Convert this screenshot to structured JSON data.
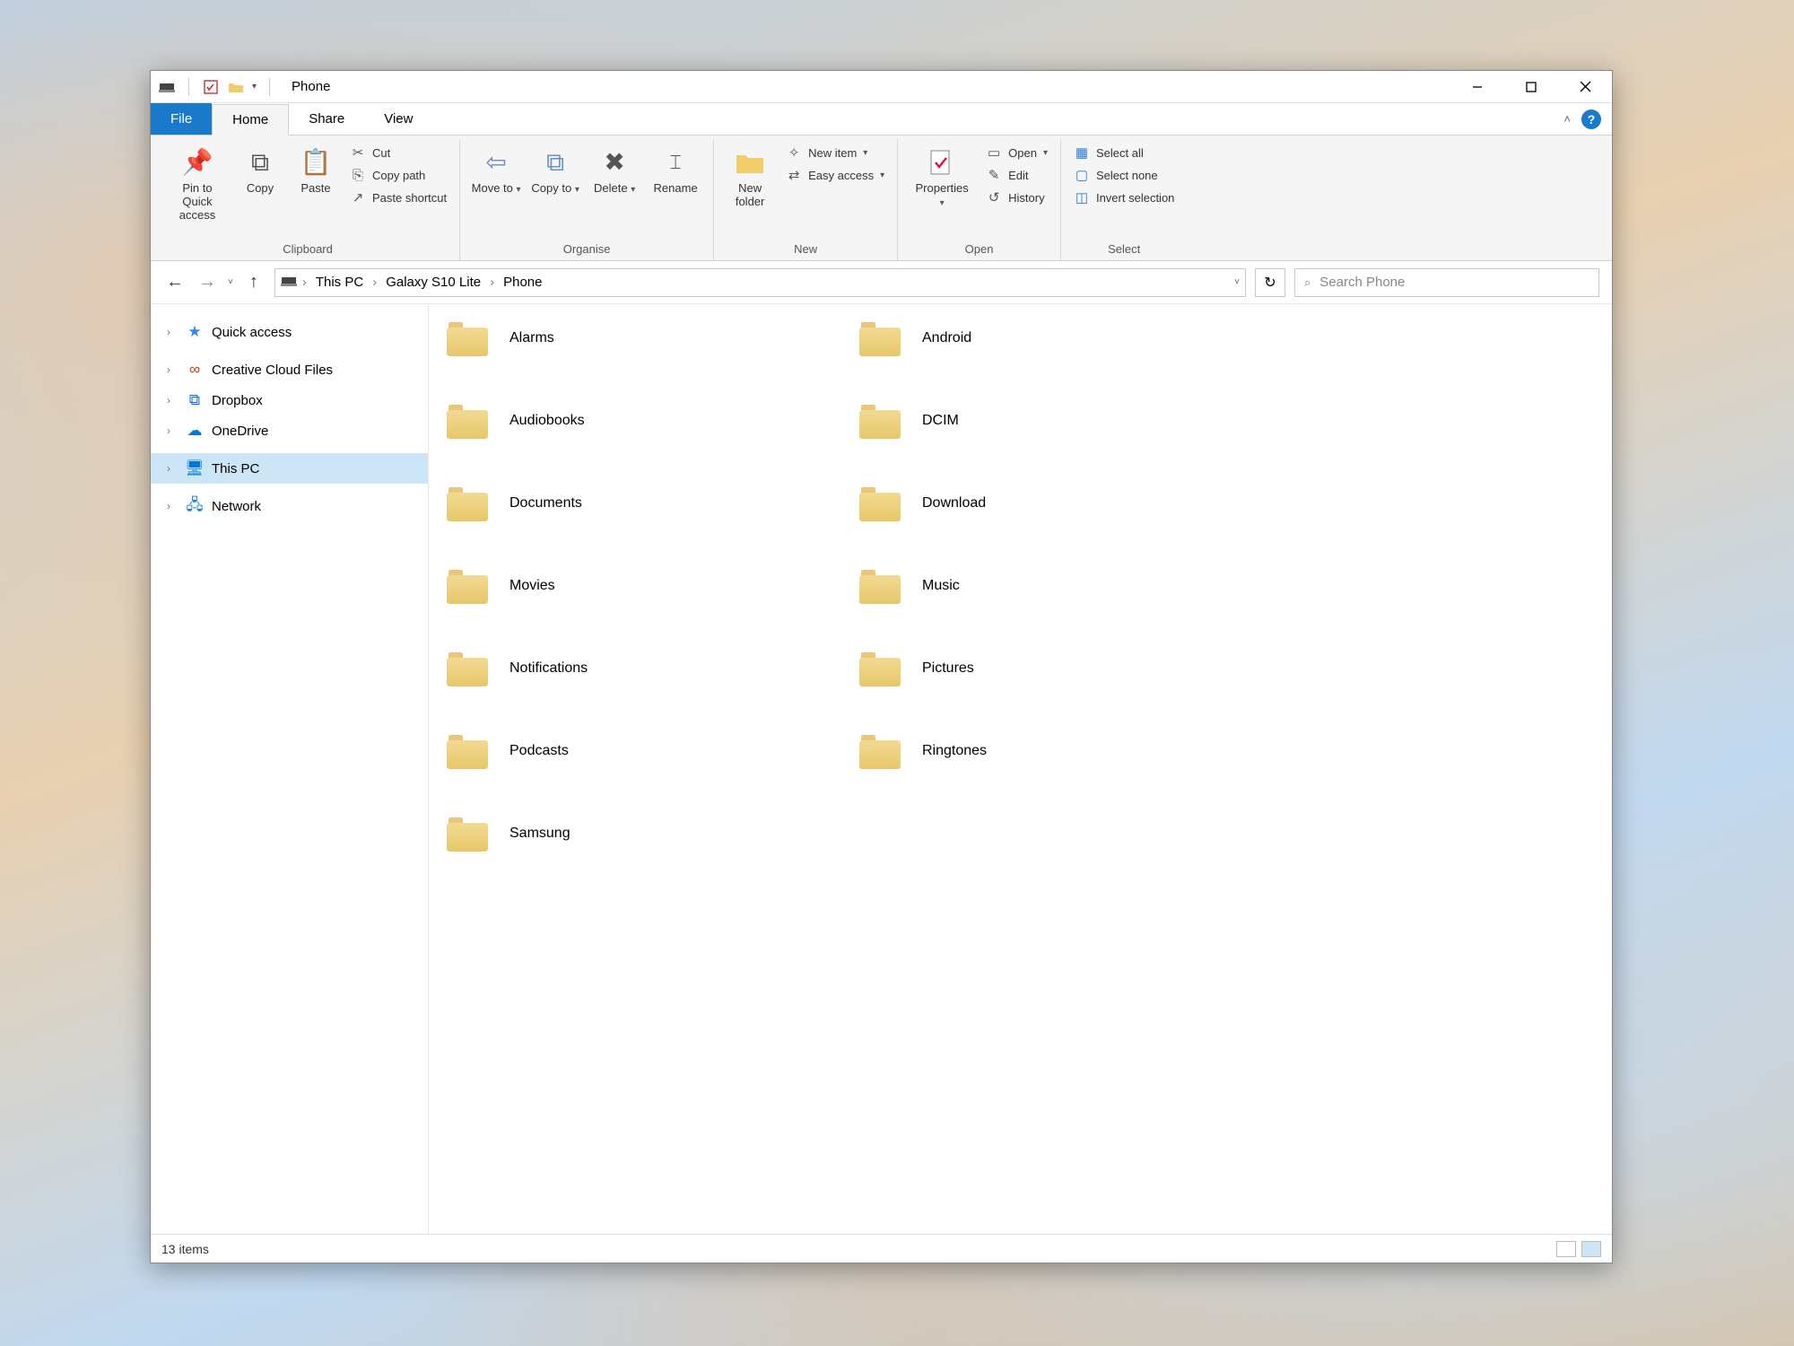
{
  "window": {
    "title": "Phone"
  },
  "tabs": {
    "file": "File",
    "home": "Home",
    "share": "Share",
    "view": "View"
  },
  "ribbon": {
    "clipboard": {
      "label": "Clipboard",
      "pin": "Pin to Quick access",
      "copy": "Copy",
      "paste": "Paste",
      "cut": "Cut",
      "copy_path": "Copy path",
      "paste_shortcut": "Paste shortcut"
    },
    "organise": {
      "label": "Organise",
      "move_to": "Move to",
      "copy_to": "Copy to",
      "delete": "Delete",
      "rename": "Rename"
    },
    "new": {
      "label": "New",
      "new_folder": "New folder",
      "new_item": "New item",
      "easy_access": "Easy access"
    },
    "open": {
      "label": "Open",
      "properties": "Properties",
      "open": "Open",
      "edit": "Edit",
      "history": "History"
    },
    "select": {
      "label": "Select",
      "select_all": "Select all",
      "select_none": "Select none",
      "invert": "Invert selection"
    }
  },
  "breadcrumb": [
    "This PC",
    "Galaxy S10 Lite",
    "Phone"
  ],
  "search": {
    "placeholder": "Search Phone"
  },
  "sidebar": {
    "items": [
      {
        "label": "Quick access",
        "icon": "★",
        "color": "#2e8be6"
      },
      {
        "label": "Creative Cloud Files",
        "icon": "∞",
        "color": "#d83b01"
      },
      {
        "label": "Dropbox",
        "icon": "⧉",
        "color": "#0061ff"
      },
      {
        "label": "OneDrive",
        "icon": "☁",
        "color": "#0078d4"
      },
      {
        "label": "This PC",
        "icon": "🖥",
        "color": "#0078d4",
        "selected": true
      },
      {
        "label": "Network",
        "icon": "🖧",
        "color": "#0078d4"
      }
    ]
  },
  "folders": [
    "Alarms",
    "Android",
    "Audiobooks",
    "DCIM",
    "Documents",
    "Download",
    "Movies",
    "Music",
    "Notifications",
    "Pictures",
    "Podcasts",
    "Ringtones",
    "Samsung"
  ],
  "status": {
    "count": "13 items"
  }
}
